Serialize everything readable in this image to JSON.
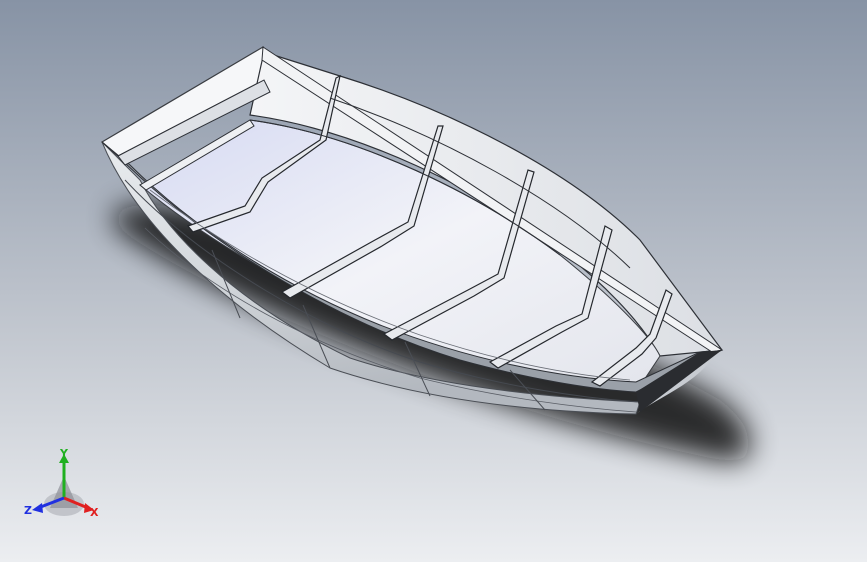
{
  "viewport": {
    "background_top": "#8a95a6",
    "background_bottom": "#e6e8ec",
    "model_name": "boat-hull"
  },
  "triad": {
    "x_label": "X",
    "y_label": "Y",
    "z_label": "Z",
    "x_color": "#e02020",
    "y_color": "#20b020",
    "z_color": "#2030e0"
  }
}
